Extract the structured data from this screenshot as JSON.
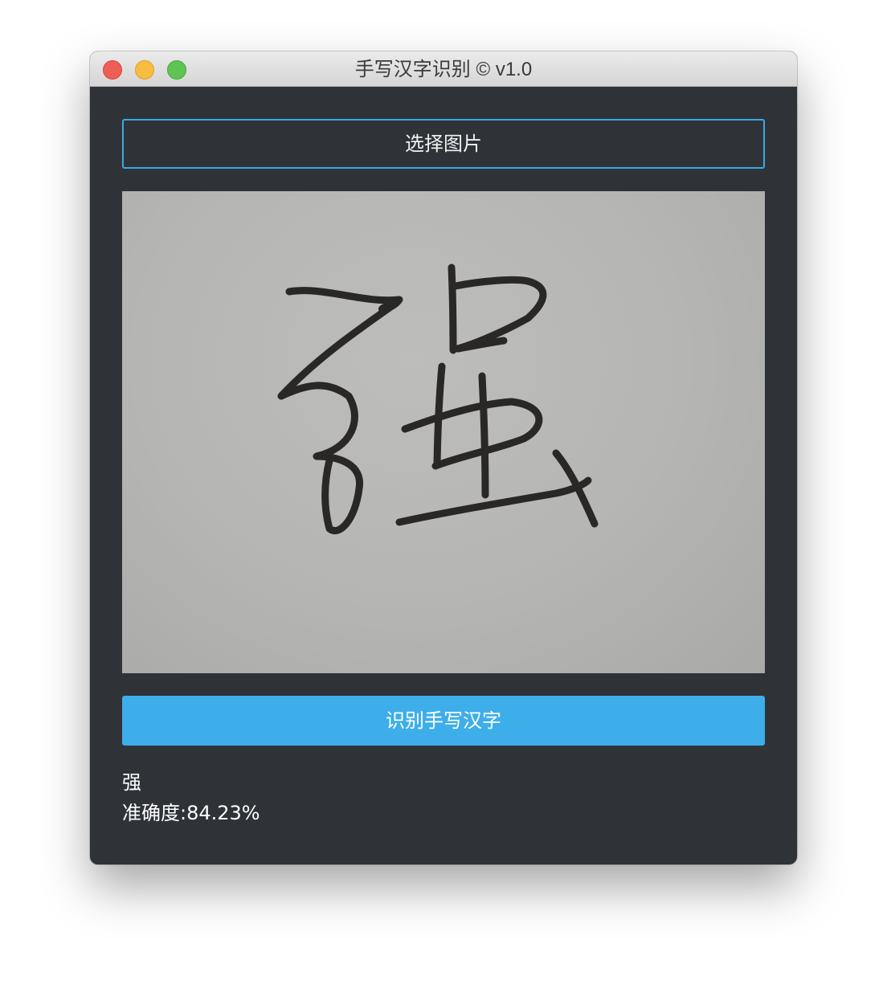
{
  "window": {
    "title": "手写汉字识别 © v1.0"
  },
  "toolbar": {
    "select_image_label": "选择图片",
    "recognize_label": "识别手写汉字"
  },
  "result": {
    "character": "强",
    "accuracy_text": "准确度:84.23%"
  },
  "colors": {
    "accent": "#3daeea",
    "background": "#2f3338"
  }
}
